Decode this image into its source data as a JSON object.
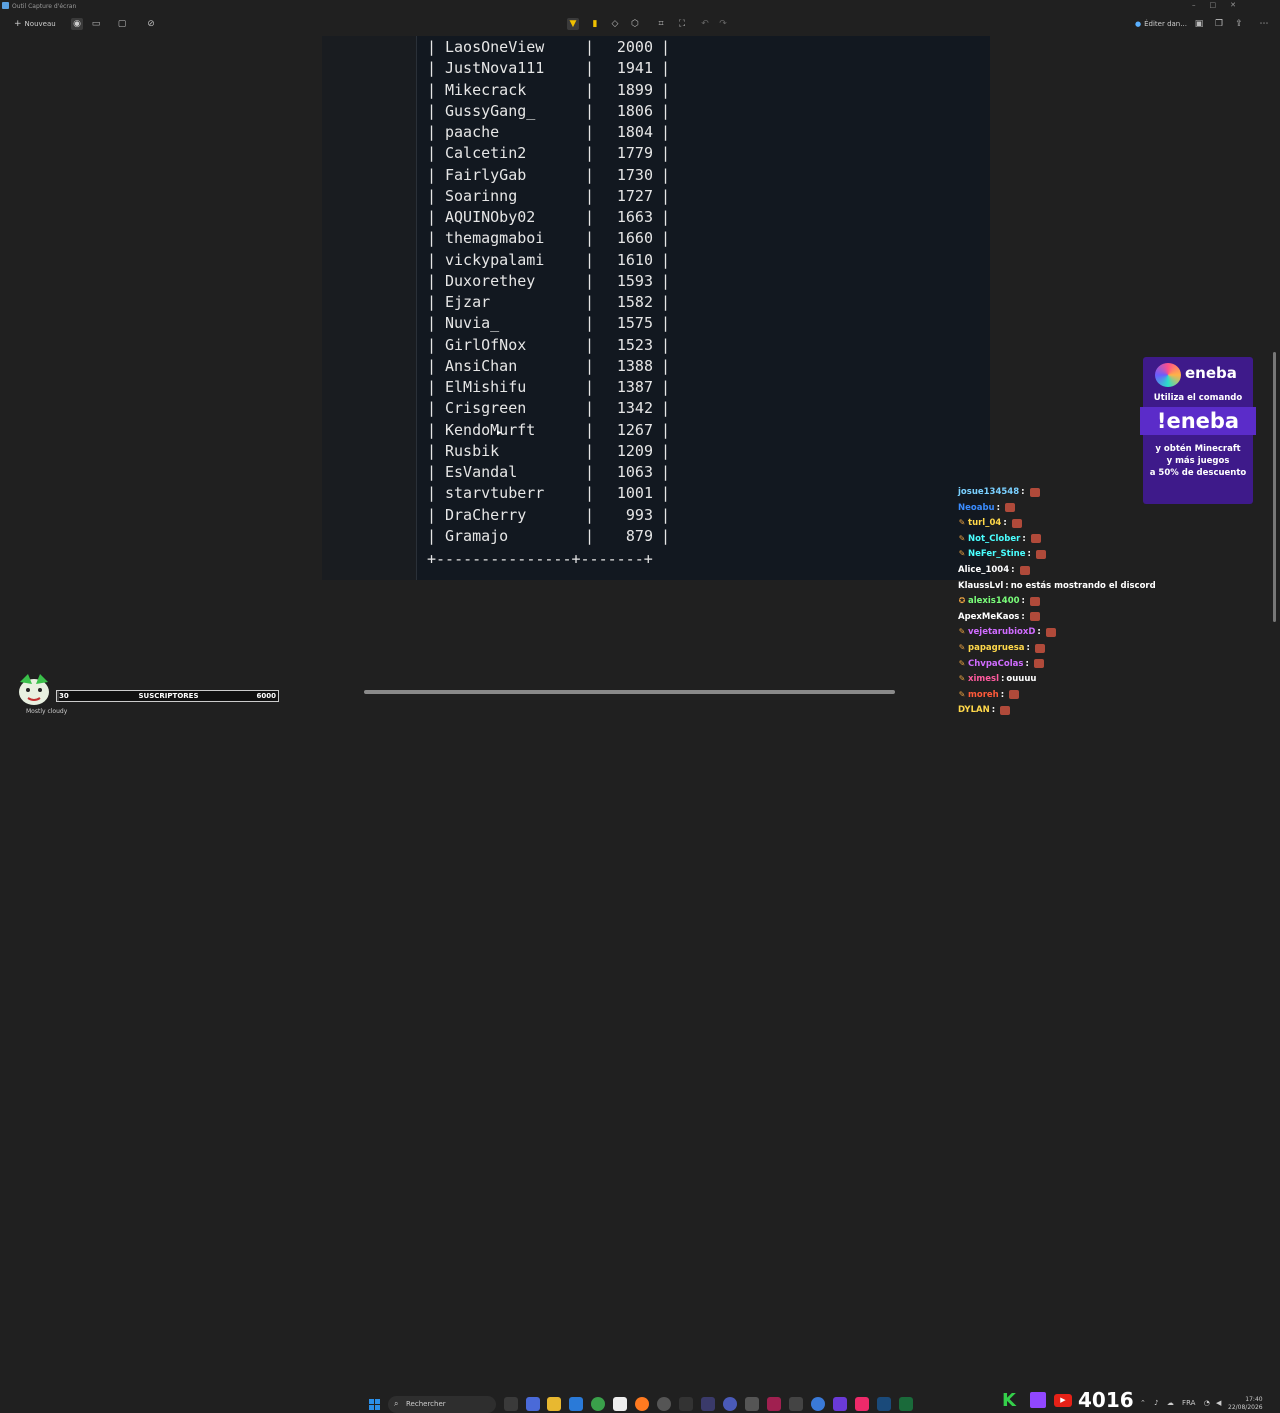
{
  "window": {
    "title": "Outil Capture d'écran"
  },
  "toolbar": {
    "new_label": "Nouveau",
    "edit_in_label": "Éditer dan..."
  },
  "leaderboard": [
    {
      "name": "LaosOneView",
      "score": "2000"
    },
    {
      "name": "JustNova111",
      "score": "1941"
    },
    {
      "name": "Mikecrack",
      "score": "1899"
    },
    {
      "name": "GussyGang_",
      "score": "1806"
    },
    {
      "name": "paache",
      "score": "1804"
    },
    {
      "name": "Calcetin2",
      "score": "1779"
    },
    {
      "name": "FairlyGab",
      "score": "1730"
    },
    {
      "name": "Soarinng",
      "score": "1727"
    },
    {
      "name": "AQUINOby02",
      "score": "1663"
    },
    {
      "name": "themagmaboi",
      "score": "1660"
    },
    {
      "name": "vickypalami",
      "score": "1610"
    },
    {
      "name": "Duxorethey",
      "score": "1593"
    },
    {
      "name": "Ejzar",
      "score": "1582"
    },
    {
      "name": "Nuvia_",
      "score": "1575"
    },
    {
      "name": "GirlOfNox",
      "score": "1523"
    },
    {
      "name": "AnsiChan",
      "score": "1388"
    },
    {
      "name": "ElMishifu",
      "score": "1387"
    },
    {
      "name": "Crisgreen",
      "score": "1342"
    },
    {
      "name": "KendoMurft",
      "score": "1267"
    },
    {
      "name": "Rusbik",
      "score": "1209"
    },
    {
      "name": "EsVandal",
      "score": "1063"
    },
    {
      "name": "starvtuberr",
      "score": "1001"
    },
    {
      "name": "DraCherry",
      "score": "993"
    },
    {
      "name": "Gramajo",
      "score": "879"
    }
  ],
  "table_border": "+---------------+-------+",
  "chat": [
    {
      "user": "josue134548",
      "color": "#7ad0ff",
      "badge": "",
      "text": ""
    },
    {
      "user": "Neoabu",
      "color": "#3a8cff",
      "badge": "",
      "text": ""
    },
    {
      "user": "turl_04",
      "color": "#ffd84a",
      "badge": "✎",
      "text": ""
    },
    {
      "user": "Not_Clober",
      "color": "#4affff",
      "badge": "✎",
      "text": ""
    },
    {
      "user": "NeFer_Stine",
      "color": "#4affff",
      "badge": "✎",
      "text": ""
    },
    {
      "user": "Alice_1004",
      "color": "#ffffff",
      "badge": "",
      "text": ""
    },
    {
      "user": "KlaussLvl",
      "color": "#ffffff",
      "badge": "",
      "text": "no estás mostrando el discord"
    },
    {
      "user": "alexis1400",
      "color": "#7aff7a",
      "badge": "✪",
      "text": ""
    },
    {
      "user": "ApexMeKaos",
      "color": "#ffffff",
      "badge": "",
      "text": ""
    },
    {
      "user": "vejetarubioxD",
      "color": "#d06cff",
      "badge": "✎",
      "text": ""
    },
    {
      "user": "papagruesa",
      "color": "#ffd84a",
      "badge": "✎",
      "text": ""
    },
    {
      "user": "ChvpaColas",
      "color": "#d06cff",
      "badge": "✎",
      "text": ""
    },
    {
      "user": "ximesl",
      "color": "#ff5a9e",
      "badge": "✎",
      "text": "ouuuu"
    },
    {
      "user": "moreh",
      "color": "#ff5a3a",
      "badge": "✎",
      "text": ""
    },
    {
      "user": "DYLAN",
      "color": "#ffd84a",
      "badge": "",
      "text": ""
    }
  ],
  "ad": {
    "brand": "eneba",
    "line1": "Utiliza el comando",
    "command": "!eneba",
    "line3a": "y obtén Minecraft",
    "line3b": "y más juegos",
    "line3c": "a 50% de descuento"
  },
  "subscribers": {
    "current": "30",
    "label": "SUSCRIPTORES",
    "goal": "6000",
    "progress": 0.005
  },
  "weather": "Mostly cloudy",
  "taskbar": {
    "search_placeholder": "Rechercher",
    "viewer_count": "4016",
    "lang": "FRA",
    "time": "17:40",
    "date": "22/08/2026"
  },
  "colors": {
    "accent": "#f0c000",
    "terminal_bg": "#121820",
    "ad_bg": "#3e1a8a",
    "twitch": "#9147ff",
    "youtube": "#e62117",
    "kick": "#34d04a"
  }
}
